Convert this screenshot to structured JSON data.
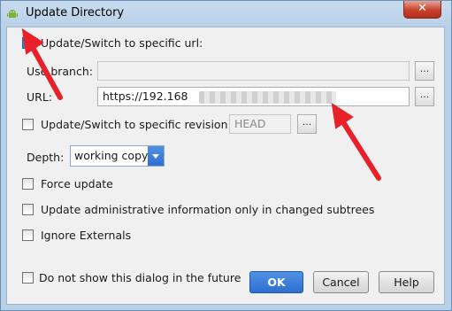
{
  "window": {
    "title": "Update Directory",
    "close_glyph": "✕"
  },
  "switch_url": {
    "label": "Update/Switch to specific url:",
    "checked": true
  },
  "use_branch": {
    "label": "Use branch:",
    "value": "",
    "browse_label": "..."
  },
  "url": {
    "label": "URL:",
    "value": "https://192.168",
    "browse_label": "..."
  },
  "switch_revision": {
    "label": "Update/Switch to specific revision:",
    "checked": false,
    "value": "HEAD",
    "browse_label": "..."
  },
  "depth": {
    "label": "Depth:",
    "value": "working copy"
  },
  "options": [
    {
      "label": "Force update",
      "checked": false
    },
    {
      "label": "Update administrative information only in changed subtrees",
      "checked": false
    },
    {
      "label": "Ignore Externals",
      "checked": false
    }
  ],
  "footer": {
    "dont_show_label": "Do not show this dialog in the future",
    "dont_show_checked": false,
    "ok_label": "OK",
    "cancel_label": "Cancel",
    "help_label": "Help"
  },
  "colors": {
    "accent": "#3c7fd8",
    "annotation_arrow": "#e8202a",
    "close": "#c8412b"
  },
  "icons": [
    "android-icon",
    "close-icon",
    "checkmark-icon",
    "dropdown-arrow-icon",
    "annotation-arrow"
  ]
}
